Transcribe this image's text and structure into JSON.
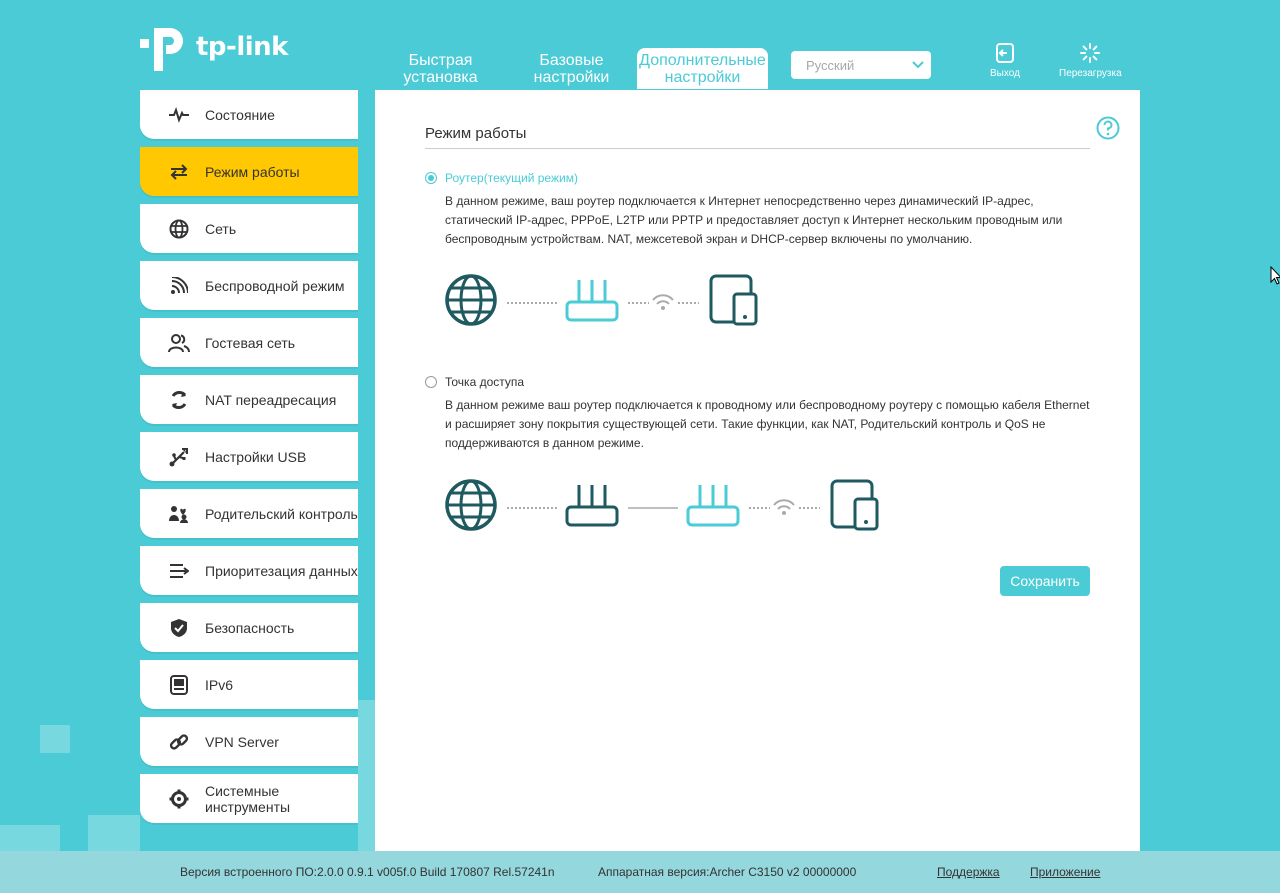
{
  "brand": {
    "logo_text": "tp-link"
  },
  "topnav": {
    "tabs": [
      {
        "label_line1": "Быстрая",
        "label_line2": "установка",
        "active": false
      },
      {
        "label_line1": "Базовые",
        "label_line2": "настройки",
        "active": false
      },
      {
        "label_line1": "Дополнительные",
        "label_line2": "настройки",
        "active": true
      }
    ],
    "language": "Русский",
    "logout_label": "Выход",
    "reboot_label": "Перезагрузка"
  },
  "sidebar": {
    "items": [
      {
        "label": "Состояние",
        "icon": "pulse-icon"
      },
      {
        "label": "Режим работы",
        "icon": "swap-icon",
        "active": true
      },
      {
        "label": "Сеть",
        "icon": "globe-icon"
      },
      {
        "label": "Беспроводной режим",
        "icon": "wifi-icon"
      },
      {
        "label": "Гостевая сеть",
        "icon": "guests-icon"
      },
      {
        "label": "NAT переадресация",
        "icon": "nat-icon"
      },
      {
        "label": "Настройки USB",
        "icon": "usb-icon"
      },
      {
        "label": "Родительский контроль",
        "icon": "parental-icon"
      },
      {
        "label": "Приоритезация данных",
        "icon": "qos-icon"
      },
      {
        "label": "Безопасность",
        "icon": "shield-icon"
      },
      {
        "label": "IPv6",
        "icon": "ipv6-icon"
      },
      {
        "label": "VPN Server",
        "icon": "link-icon"
      },
      {
        "label": "Системные инструменты",
        "icon": "gear-icon"
      }
    ]
  },
  "main": {
    "title": "Режим работы",
    "router_mode": {
      "label": "Роутер(текущий режим)",
      "selected": true,
      "description": "В данном режиме, ваш роутер подключается к Интернет непосредственно через динамический IP-адрес, статический IP-адрес, PPPoE, L2TP или PPTP и предоставляет доступ к Интернет нескольким проводным или беспроводным устройствам. NAT, межсетевой экран и DHCP-сервер включены по умолчанию."
    },
    "ap_mode": {
      "label": "Точка доступа",
      "selected": false,
      "description": "В данном режиме ваш роутер подключается к проводному или беспроводному роутеру с помощью кабеля Ethernet и расширяет зону покрытия существующей сети. Такие функции, как NAT, Родительский контроль и QoS не поддерживаются в данном режиме."
    },
    "save_label": "Сохранить"
  },
  "footer": {
    "firmware": "Версия встроенного ПО:2.0.0 0.9.1 v005f.0 Build 170807 Rel.57241n",
    "hardware": "Аппаратная версия:Archer C3150 v2 00000000",
    "support_link": "Поддержка",
    "app_link": "Приложение"
  },
  "colors": {
    "accent": "#4acbd6",
    "active_item": "#ffc800",
    "icon_dark": "#1e5a5f"
  }
}
